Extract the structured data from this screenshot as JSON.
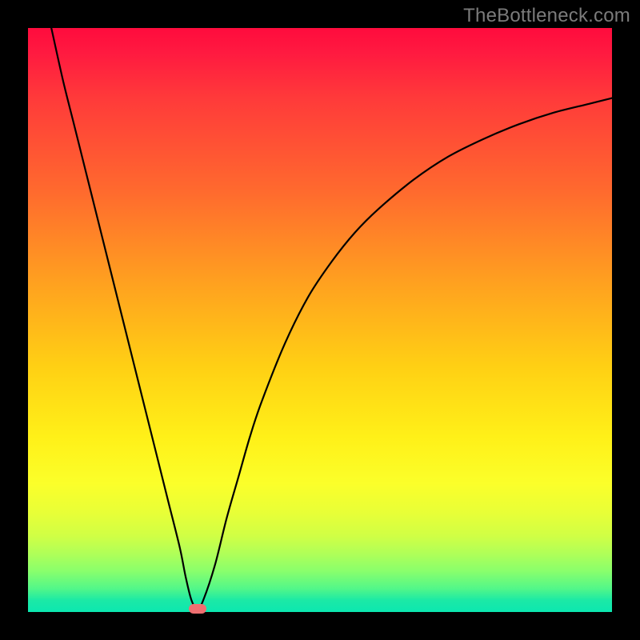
{
  "watermark": "TheBottleneck.com",
  "chart_data": {
    "type": "line",
    "title": "",
    "xlabel": "",
    "ylabel": "",
    "xlim": [
      0,
      100
    ],
    "ylim": [
      0,
      100
    ],
    "grid": false,
    "legend": false,
    "series": [
      {
        "name": "bottleneck-curve",
        "x": [
          4,
          6,
          8,
          10,
          12,
          14,
          16,
          18,
          20,
          22,
          24,
          26,
          27,
          28,
          29,
          30,
          32,
          34,
          36,
          38,
          40,
          44,
          48,
          52,
          56,
          60,
          66,
          72,
          78,
          84,
          90,
          96,
          100
        ],
        "y": [
          100,
          91,
          83,
          75,
          67,
          59,
          51,
          43,
          35,
          27,
          19,
          11,
          6,
          2,
          0.5,
          2,
          8,
          16,
          23,
          30,
          36,
          46,
          54,
          60,
          65,
          69,
          74,
          78,
          81,
          83.5,
          85.5,
          87,
          88
        ]
      }
    ],
    "marker": {
      "x": 29,
      "y": 0.5,
      "color": "#ef6f71"
    },
    "background_gradient": {
      "top": "#ff0b3d",
      "mid": "#ffd014",
      "bottom": "#0ce7b0"
    }
  }
}
